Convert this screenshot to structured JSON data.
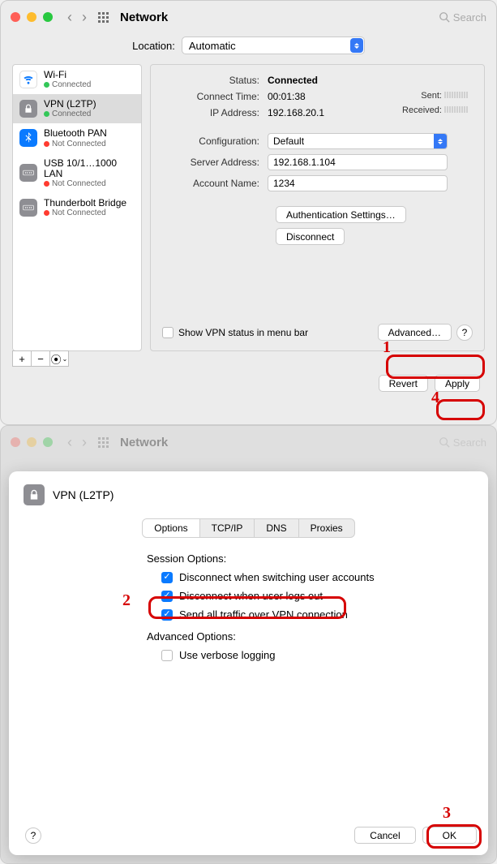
{
  "window1": {
    "title": "Network",
    "search_placeholder": "Search",
    "location_label": "Location:",
    "location_value": "Automatic",
    "sidebar": [
      {
        "name": "Wi-Fi",
        "status": "Connected",
        "dot": "g",
        "icon": "wifi"
      },
      {
        "name": "VPN (L2TP)",
        "status": "Connected",
        "dot": "g",
        "icon": "vpn"
      },
      {
        "name": "Bluetooth PAN",
        "status": "Not Connected",
        "dot": "r",
        "icon": "bt"
      },
      {
        "name": "USB 10/1…1000 LAN",
        "status": "Not Connected",
        "dot": "r",
        "icon": "usb"
      },
      {
        "name": "Thunderbolt Bridge",
        "status": "Not Connected",
        "dot": "r",
        "icon": "usb"
      }
    ],
    "status_label": "Status:",
    "status_value": "Connected",
    "connect_time_label": "Connect Time:",
    "connect_time_value": "00:01:38",
    "ip_label": "IP Address:",
    "ip_value": "192.168.20.1",
    "sent_label": "Sent:",
    "received_label": "Received:",
    "config_label": "Configuration:",
    "config_value": "Default",
    "server_label": "Server Address:",
    "server_value": "192.168.1.104",
    "account_label": "Account Name:",
    "account_value": "1234",
    "auth_btn": "Authentication Settings…",
    "disconnect_btn": "Disconnect",
    "show_vpn_label": "Show VPN status in menu bar",
    "advanced_btn": "Advanced…",
    "revert_btn": "Revert",
    "apply_btn": "Apply",
    "annot1": "1",
    "annot4": "4"
  },
  "window2": {
    "title": "Network",
    "search_placeholder": "Search",
    "sheet_title": "VPN (L2TP)",
    "tabs": [
      "Options",
      "TCP/IP",
      "DNS",
      "Proxies"
    ],
    "session_title": "Session Options:",
    "opt1": "Disconnect when switching user accounts",
    "opt2": "Disconnect when user logs out",
    "opt3": "Send all traffic over VPN connection",
    "advanced_title": "Advanced Options:",
    "opt4": "Use verbose logging",
    "cancel_btn": "Cancel",
    "ok_btn": "OK",
    "annot2": "2",
    "annot3": "3"
  }
}
